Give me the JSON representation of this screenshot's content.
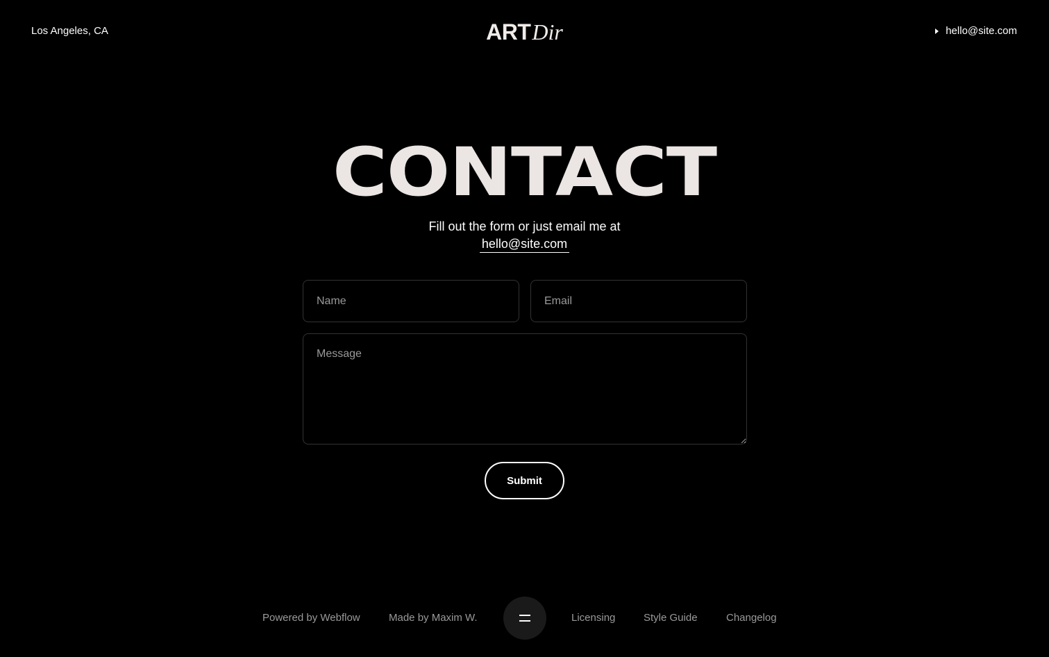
{
  "header": {
    "location": "Los Angeles, CA",
    "logo_primary": "ART",
    "logo_secondary": "Dir",
    "email": "hello@site.com",
    "email_icon": "triangle-right-icon"
  },
  "hero": {
    "title": "CONTACT",
    "subtitle": "Fill out the form or just email me at",
    "email": "hello@site.com"
  },
  "form": {
    "name_placeholder": "Name",
    "email_placeholder": "Email",
    "message_placeholder": "Message",
    "submit_label": "Submit"
  },
  "footer": {
    "powered_by": "Powered by Webflow",
    "made_by": "Made by Maxim W.",
    "menu_icon": "menu-icon",
    "licensing": "Licensing",
    "style_guide": "Style Guide",
    "changelog": "Changelog"
  },
  "colors": {
    "background": "#000000",
    "text": "#ffffff",
    "title": "#ebe5e3",
    "muted": "#9a9a9a",
    "field_border": "#333333",
    "menu_button": "#1a1a1a"
  }
}
